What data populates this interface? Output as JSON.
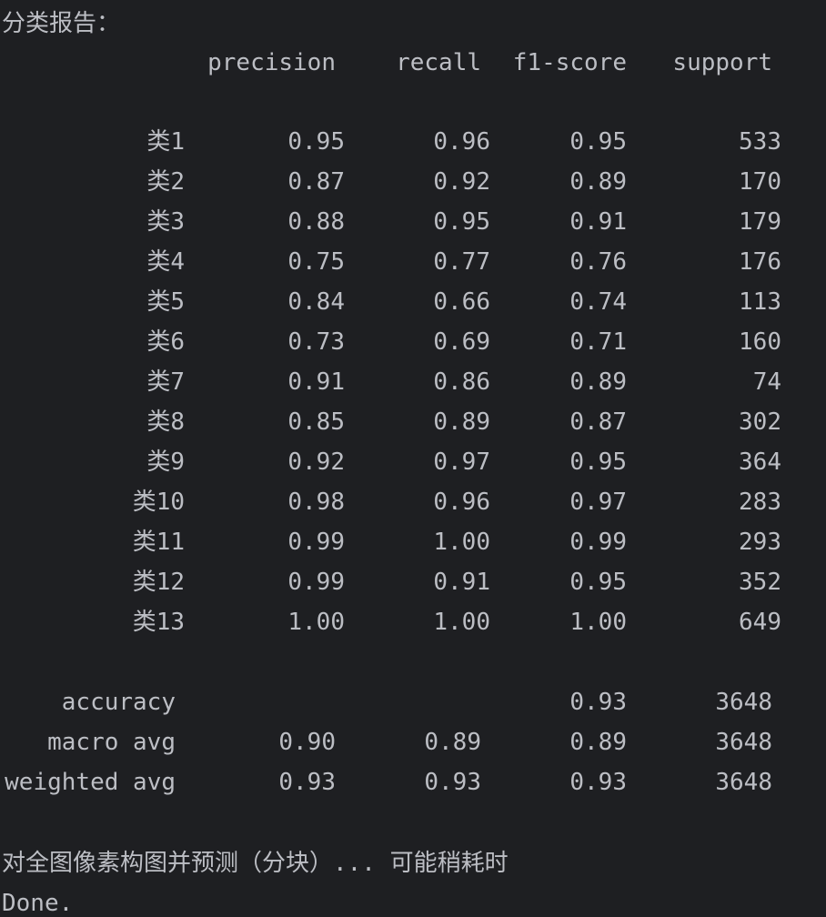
{
  "report_title": "分类报告：",
  "headers": {
    "precision": "precision",
    "recall": "recall",
    "f1": "f1-score",
    "support": "support"
  },
  "rows": [
    {
      "label": "类1",
      "precision": "0.95",
      "recall": "0.96",
      "f1": "0.95",
      "support": "533"
    },
    {
      "label": "类2",
      "precision": "0.87",
      "recall": "0.92",
      "f1": "0.89",
      "support": "170"
    },
    {
      "label": "类3",
      "precision": "0.88",
      "recall": "0.95",
      "f1": "0.91",
      "support": "179"
    },
    {
      "label": "类4",
      "precision": "0.75",
      "recall": "0.77",
      "f1": "0.76",
      "support": "176"
    },
    {
      "label": "类5",
      "precision": "0.84",
      "recall": "0.66",
      "f1": "0.74",
      "support": "113"
    },
    {
      "label": "类6",
      "precision": "0.73",
      "recall": "0.69",
      "f1": "0.71",
      "support": "160"
    },
    {
      "label": "类7",
      "precision": "0.91",
      "recall": "0.86",
      "f1": "0.89",
      "support": "74"
    },
    {
      "label": "类8",
      "precision": "0.85",
      "recall": "0.89",
      "f1": "0.87",
      "support": "302"
    },
    {
      "label": "类9",
      "precision": "0.92",
      "recall": "0.97",
      "f1": "0.95",
      "support": "364"
    },
    {
      "label": "类10",
      "precision": "0.98",
      "recall": "0.96",
      "f1": "0.97",
      "support": "283"
    },
    {
      "label": "类11",
      "precision": "0.99",
      "recall": "1.00",
      "f1": "0.99",
      "support": "293"
    },
    {
      "label": "类12",
      "precision": "0.99",
      "recall": "0.91",
      "f1": "0.95",
      "support": "352"
    },
    {
      "label": "类13",
      "precision": "1.00",
      "recall": "1.00",
      "f1": "1.00",
      "support": "649"
    }
  ],
  "summary": [
    {
      "label": "accuracy",
      "precision": "",
      "recall": "",
      "f1": "0.93",
      "support": "3648"
    },
    {
      "label": "macro avg",
      "precision": "0.90",
      "recall": "0.89",
      "f1": "0.89",
      "support": "3648"
    },
    {
      "label": "weighted avg",
      "precision": "0.93",
      "recall": "0.93",
      "f1": "0.93",
      "support": "3648"
    }
  ],
  "status_message": "对全图像素构图并预测（分块）... 可能稍耗时",
  "done_message": "Done."
}
